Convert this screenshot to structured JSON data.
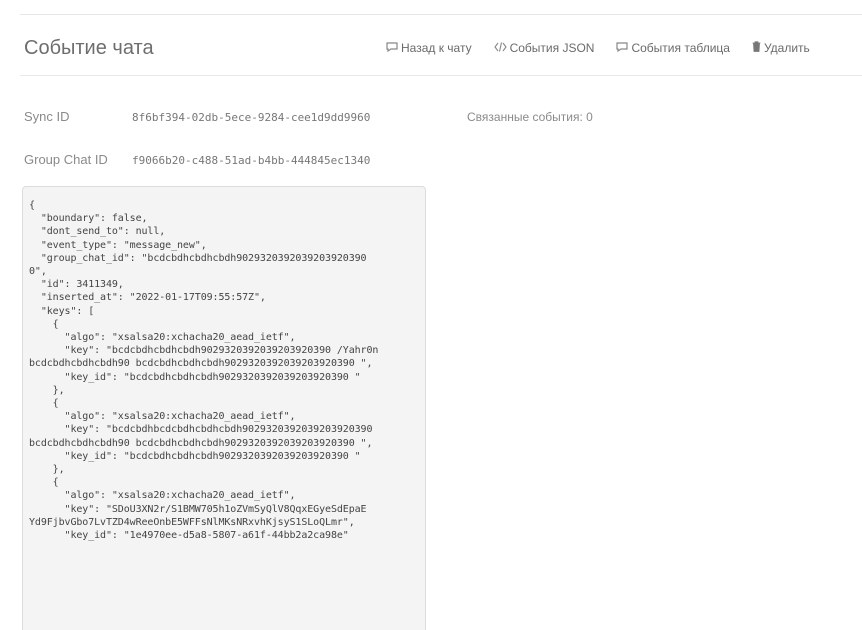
{
  "header": {
    "title": "Событие чата",
    "actions": [
      {
        "label": "Назад к чату",
        "icon": "chat-bubble-icon"
      },
      {
        "label": "События JSON",
        "icon": "code-icon"
      },
      {
        "label": "События таблица",
        "icon": "chat-bubble-icon"
      },
      {
        "label": "Удалить",
        "icon": "trash-icon"
      }
    ]
  },
  "meta": {
    "sync_id_label": "Sync ID",
    "sync_id_value": "8f6bf394-02db-5ece-9284-cee1d9dd9960",
    "related_label": "Связанные события: 0",
    "group_chat_id_label": "Group Chat ID",
    "group_chat_id_value": "f9066b20-c488-51ad-b4bb-444845ec1340"
  },
  "json_text": "{\n  \"boundary\": false,\n  \"dont_send_to\": null,\n  \"event_type\": \"message_new\",\n  \"group_chat_id\": \"bcdcbdhcbdhcbdh9029320392039203920390\n0\",\n  \"id\": 3411349,\n  \"inserted_at\": \"2022-01-17T09:55:57Z\",\n  \"keys\": [\n    {\n      \"algo\": \"xsalsa20:xchacha20_aead_ietf\",\n      \"key\": \"bcdcbdhcbdhcbdh9029320392039203920390 /Yahr0n\nbcdcbdhcbdhcbdh90 bcdcbdhcbdhcbdh9029320392039203920390 \",\n      \"key_id\": \"bcdcbdhcbdhcbdh9029320392039203920390 \"\n    },\n    {\n      \"algo\": \"xsalsa20:xchacha20_aead_ietf\",\n      \"key\": \"bcdcbdhbcdcbdhcbdhcbdh9029320392039203920390\nbcdcbdhcbdhcbdh90 bcdcbdhcbdhcbdh9029320392039203920390 \",\n      \"key_id\": \"bcdcbdhcbdhcbdh9029320392039203920390 \"\n    },\n    {\n      \"algo\": \"xsalsa20:xchacha20_aead_ietf\",\n      \"key\": \"SDoU3XN2r/S1BMW705h1oZVmSyQlV8QqxEGyeSdEpaE\nYd9FjbvGbo7LvTZD4wReeOnbE5WFFsNlMKsNRxvhKjsyS1SLoQLmr\",\n      \"key_id\": \"1e4970ee-d5a8-5807-a61f-44bb2a2ca98e\""
}
